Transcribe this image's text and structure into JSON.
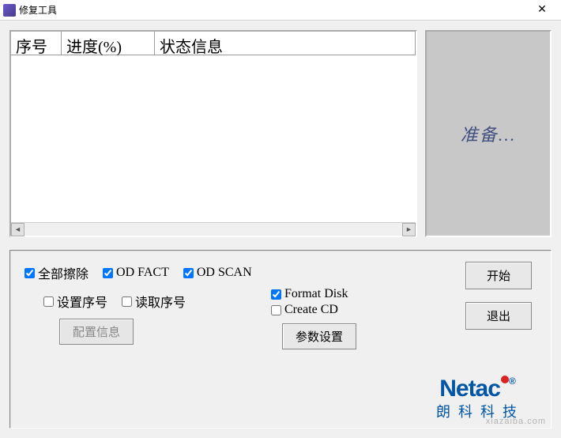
{
  "window": {
    "title": "修复工具",
    "close_glyph": "✕"
  },
  "table": {
    "headers": {
      "col1": "序号",
      "col2": "进度(%)",
      "col3": "状态信息"
    },
    "scroll": {
      "left_glyph": "◄",
      "right_glyph": "►"
    }
  },
  "status": {
    "text": "准备..."
  },
  "options": {
    "erase_all": {
      "label": "全部擦除",
      "checked": true
    },
    "od_fact": {
      "label": "OD FACT",
      "checked": true
    },
    "od_scan": {
      "label": "OD SCAN",
      "checked": true
    },
    "set_serial": {
      "label": "设置序号",
      "checked": false
    },
    "read_serial": {
      "label": "读取序号",
      "checked": false
    },
    "format_disk": {
      "label": "Format Disk",
      "checked": true
    },
    "create_cd": {
      "label": "Create CD",
      "checked": false
    }
  },
  "buttons": {
    "config_info": "配置信息",
    "param_settings": "参数设置",
    "start": "开始",
    "exit": "退出"
  },
  "brand": {
    "name": "Netac",
    "reg": "®",
    "sub": "朗科科技"
  },
  "watermark": "xiazaiba.com"
}
